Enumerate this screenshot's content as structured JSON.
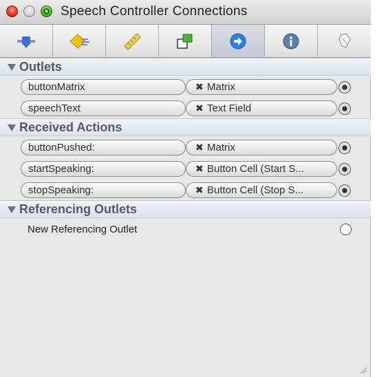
{
  "window": {
    "title": "Speech Controller Connections"
  },
  "toolbar": {
    "tabs": [
      {
        "icon": "attributes-icon",
        "active": false
      },
      {
        "icon": "effects-icon",
        "active": false
      },
      {
        "icon": "size-ruler-icon",
        "active": false
      },
      {
        "icon": "bindings-icon",
        "active": false
      },
      {
        "icon": "connections-icon",
        "active": true
      },
      {
        "icon": "info-icon",
        "active": false
      },
      {
        "icon": "identity-icon",
        "active": false
      }
    ]
  },
  "sections": {
    "outlets": {
      "label": "Outlets",
      "rows": [
        {
          "source": "buttonMatrix",
          "target": "Matrix"
        },
        {
          "source": "speechText",
          "target": "Text Field"
        }
      ]
    },
    "actions": {
      "label": "Received Actions",
      "rows": [
        {
          "source": "buttonPushed:",
          "target": "Matrix"
        },
        {
          "source": "startSpeaking:",
          "target": "Button Cell (Start S..."
        },
        {
          "source": "stopSpeaking:",
          "target": "Button Cell (Stop S..."
        }
      ]
    },
    "referencing": {
      "label": "Referencing Outlets",
      "new_label": "New Referencing Outlet"
    }
  },
  "colors": {
    "section_header_text": "#555a63",
    "active_tab_blue": "#2f7fe0"
  }
}
